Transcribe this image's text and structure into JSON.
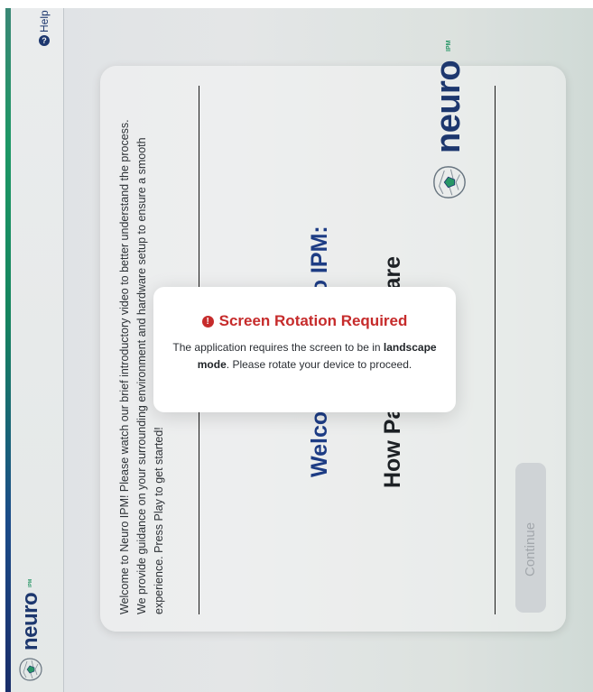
{
  "header": {
    "help_label": "Help",
    "help_icon": "?",
    "brand": "neuro",
    "brand_sub": "IPM"
  },
  "card": {
    "intro_text": "Welcome to Neuro IPM! Please watch our brief introductory video to better understand the process. We provide guidance on your surrounding environment and hardware setup to ensure a smooth experience. Press Play to get started!",
    "title_line1": "Welcome to Neuro IPM:",
    "title_line2": "How Patients Prepare",
    "continue_label": "Continue",
    "brand": "neuro",
    "brand_sub": "IPM"
  },
  "modal": {
    "title": "Screen Rotation Required",
    "icon": "!",
    "message_before": "The application requires the screen to be in ",
    "message_bold": "landscape mode",
    "message_after": ". Please rotate your device to proceed."
  },
  "colors": {
    "brand_blue": "#1f3a73",
    "brand_green": "#2a9d6b",
    "alert_red": "#c62b2b"
  }
}
